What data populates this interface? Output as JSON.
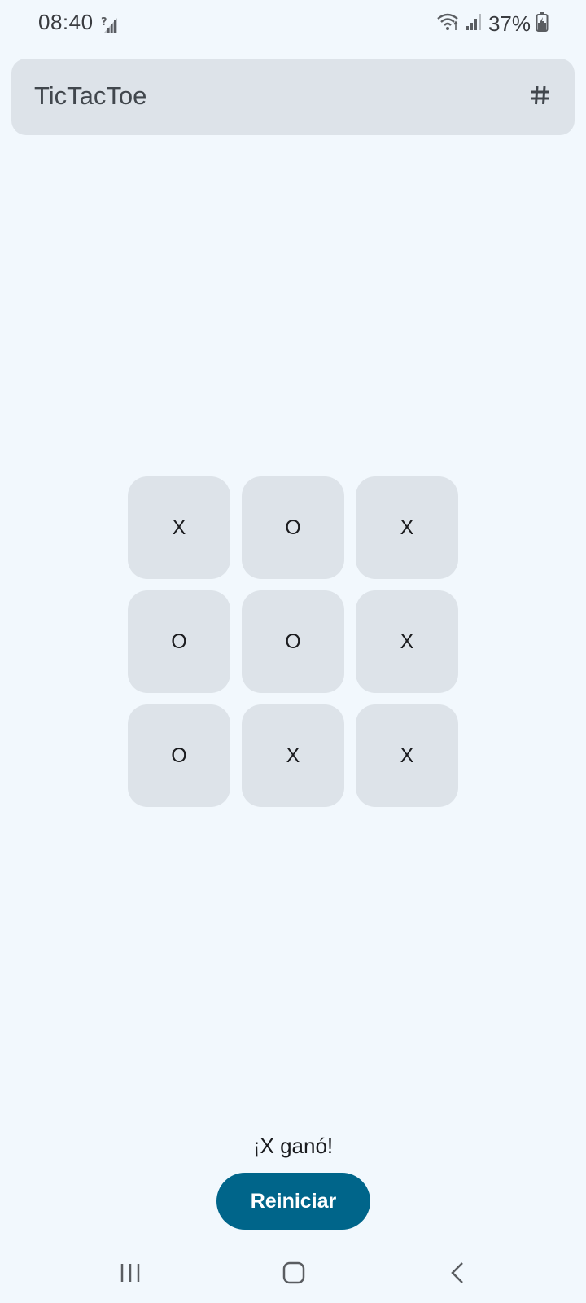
{
  "status_bar": {
    "time": "08:40",
    "battery_percent": "37%",
    "icons": [
      "no-sim-signal-icon",
      "wifi-icon",
      "cell-signal-icon",
      "battery-charging-icon"
    ]
  },
  "app_bar": {
    "title": "TicTacToe",
    "action_icon": "hash-icon"
  },
  "board": {
    "cells": [
      "X",
      "O",
      "X",
      "O",
      "O",
      "X",
      "O",
      "X",
      "X"
    ]
  },
  "result_text": "¡X ganó!",
  "restart_label": "Reiniciar",
  "nav_bar": {
    "icons": [
      "recent-apps-icon",
      "home-icon",
      "back-icon"
    ]
  },
  "colors": {
    "background": "#f2f8fd",
    "surface": "#dde3e9",
    "primary": "#00658a",
    "on_primary": "#ffffff",
    "text": "#1b1c1f"
  }
}
